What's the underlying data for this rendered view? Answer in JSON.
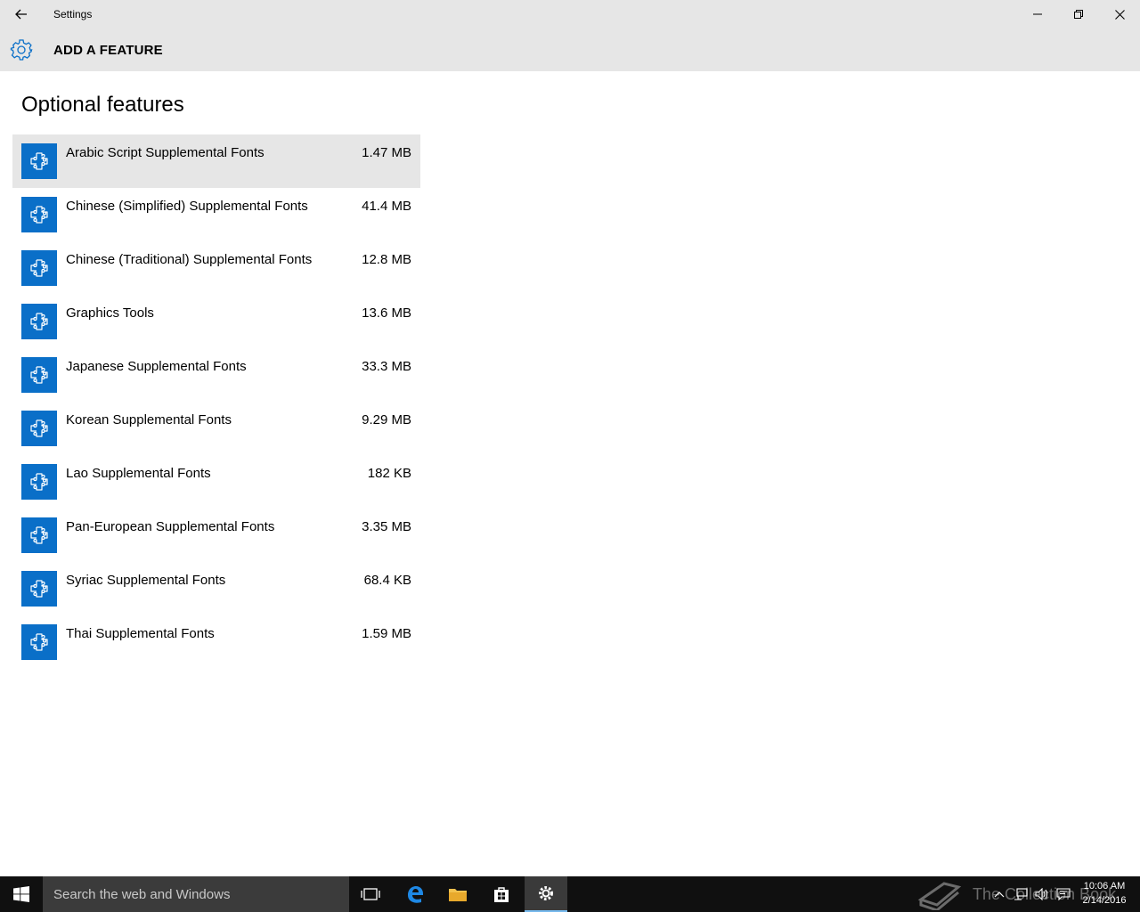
{
  "window": {
    "title": "Settings"
  },
  "header": {
    "title": "ADD A FEATURE",
    "icon": "gear-icon"
  },
  "page": {
    "heading": "Optional features"
  },
  "features": [
    {
      "name": "Arabic Script Supplemental Fonts",
      "size": "1.47 MB",
      "selected": true
    },
    {
      "name": "Chinese (Simplified) Supplemental Fonts",
      "size": "41.4 MB"
    },
    {
      "name": "Chinese (Traditional) Supplemental Fonts",
      "size": "12.8 MB"
    },
    {
      "name": "Graphics Tools",
      "size": "13.6 MB"
    },
    {
      "name": "Japanese Supplemental Fonts",
      "size": "33.3 MB"
    },
    {
      "name": "Korean Supplemental Fonts",
      "size": "9.29 MB"
    },
    {
      "name": "Lao Supplemental Fonts",
      "size": "182 KB"
    },
    {
      "name": "Pan-European Supplemental Fonts",
      "size": "3.35 MB"
    },
    {
      "name": "Syriac Supplemental Fonts",
      "size": "68.4 KB"
    },
    {
      "name": "Thai Supplemental Fonts",
      "size": "1.59 MB"
    }
  ],
  "taskbar": {
    "search_placeholder": "Search the web and Windows",
    "watermark": "The Collection Book",
    "time": "10:06 AM",
    "date": "2/14/2016"
  },
  "colors": {
    "accent": "#0a6fc8",
    "titlebar": "#e6e6e6",
    "taskbar": "#101010"
  }
}
